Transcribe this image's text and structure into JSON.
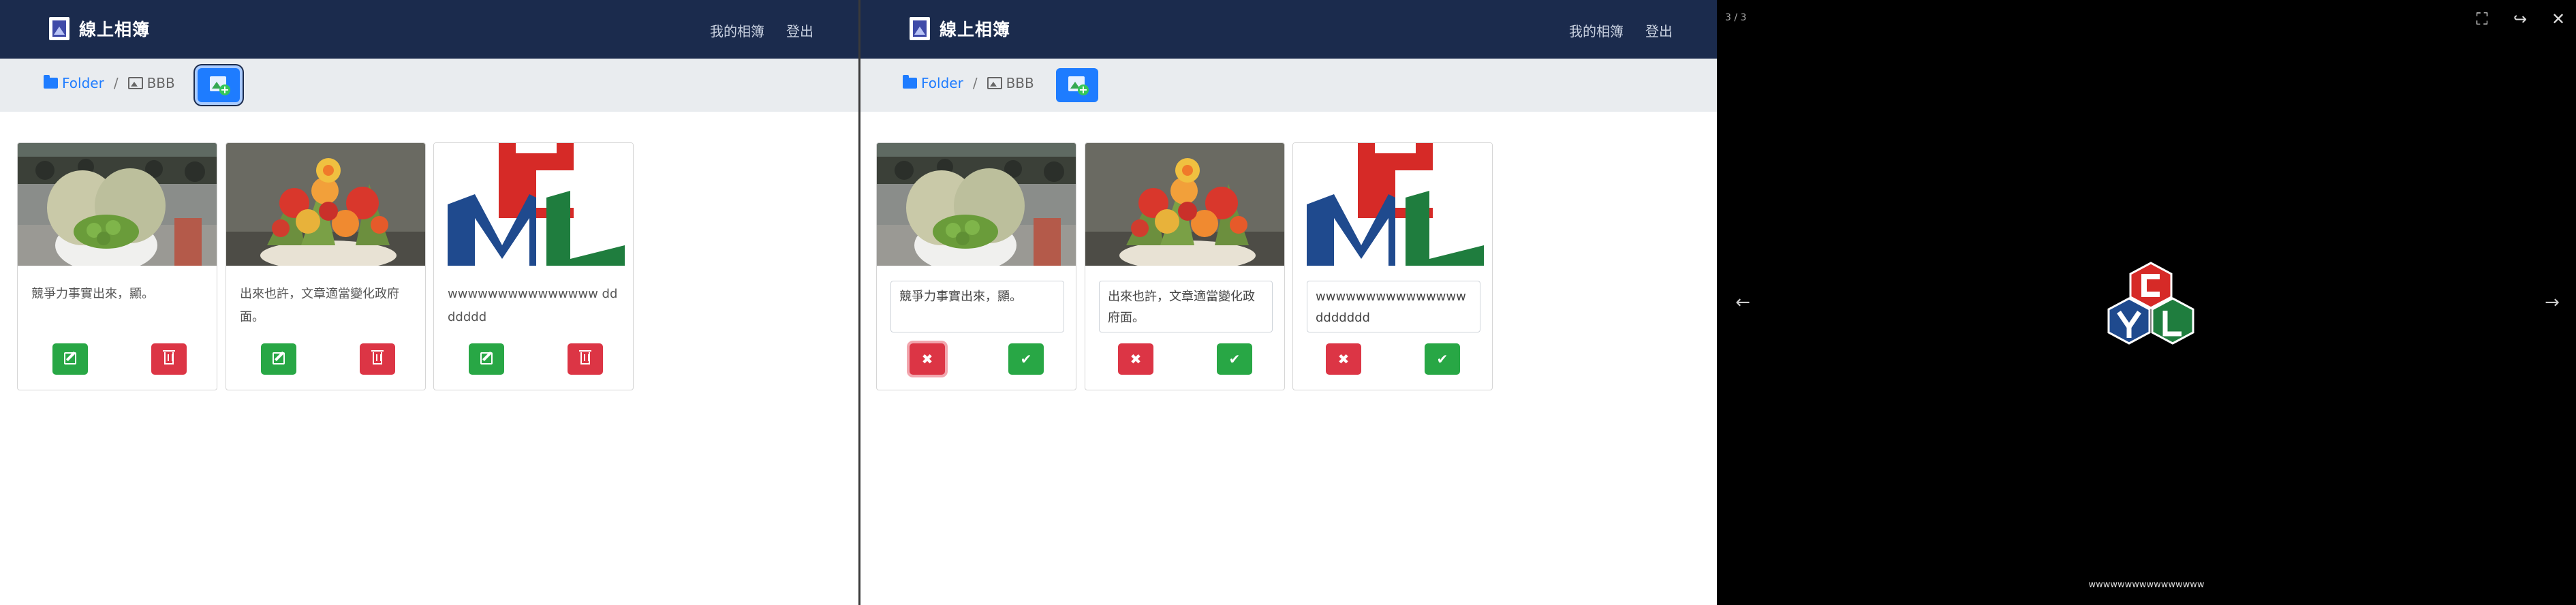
{
  "app": {
    "brand": "線上相簿",
    "nav_my_albums": "我的相簿",
    "nav_logout": "登出"
  },
  "breadcrumb": {
    "folder": "Folder",
    "separator": "/",
    "current": "BBB"
  },
  "cards": [
    {
      "caption": "競爭力事實出來，顯。"
    },
    {
      "caption": "出來也許，文章適當變化政府面。"
    },
    {
      "caption": "wwwwwwwwwwwwwww ddddddd"
    }
  ],
  "viewer": {
    "counter": "3 / 3",
    "caption": "wwwwwwwwwwwwwwww",
    "fullscreen_icon": "⛶",
    "share_icon": "↪",
    "close_icon": "✕",
    "prev_icon": "←",
    "next_icon": "→"
  },
  "icons": {
    "edit": "edit-icon",
    "delete": "trash-icon",
    "cancel": "✖",
    "confirm": "✔"
  },
  "colors": {
    "navbar": "#1b2b4d",
    "primary": "#1e7cff",
    "success": "#28a745",
    "danger": "#dc3545"
  }
}
